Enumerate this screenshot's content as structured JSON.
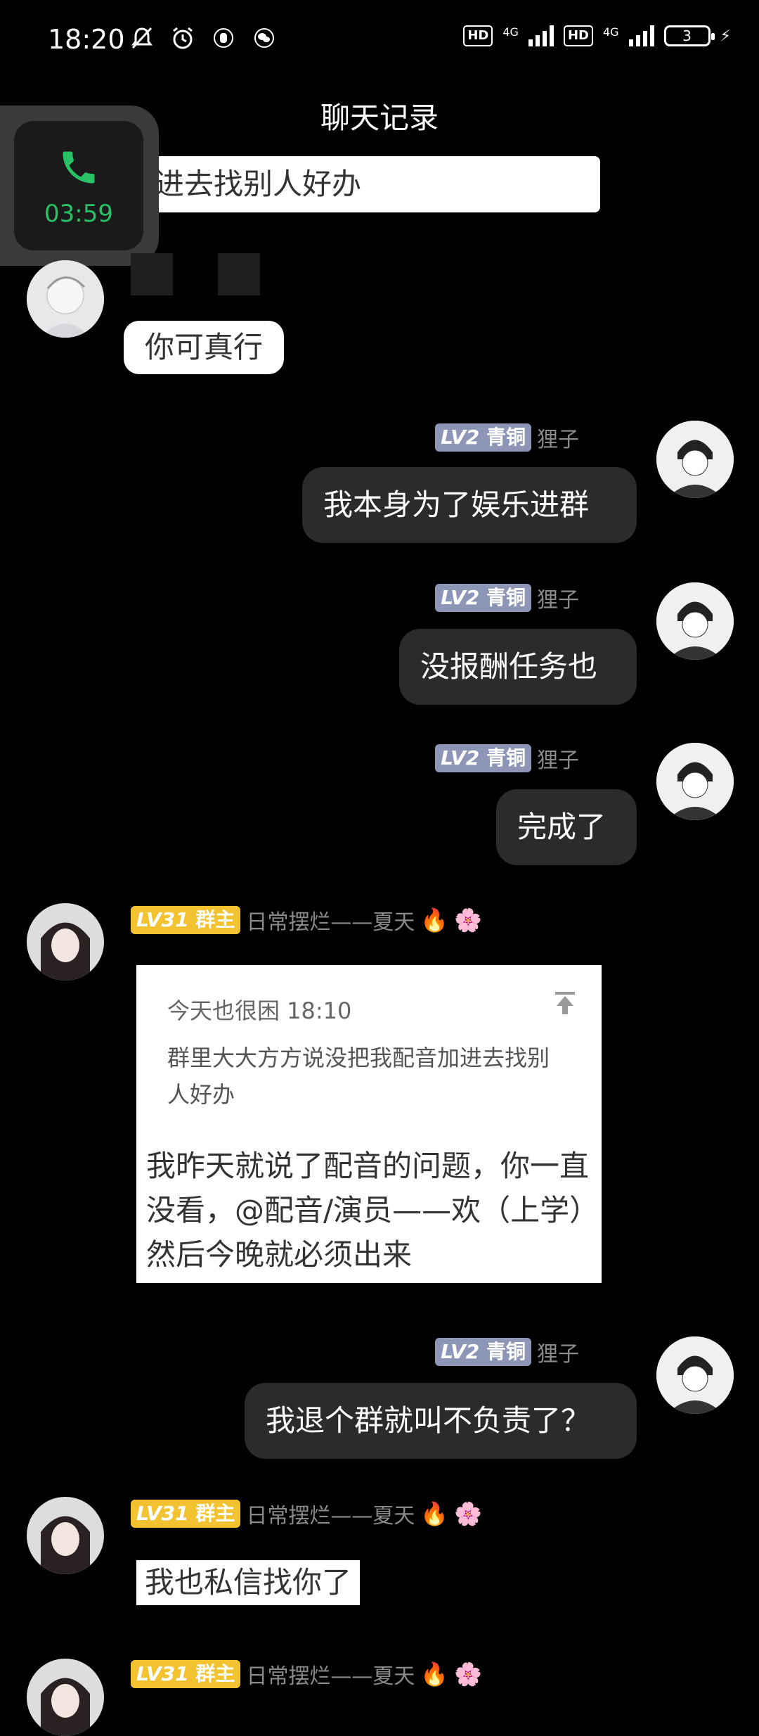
{
  "status_bar": {
    "time": "18:20",
    "battery": "3",
    "net1": "4G",
    "net2": "4G",
    "hd": "HD"
  },
  "nav": {
    "title": "聊天记录"
  },
  "call": {
    "duration": "03:59"
  },
  "messages": {
    "partial_top": "进去找别人好办",
    "m1": "你可真行",
    "m2": {
      "level": "LV2",
      "rank": "青铜",
      "name": "狸子",
      "text": "我本身为了娱乐进群"
    },
    "m3": {
      "level": "LV2",
      "rank": "青铜",
      "name": "狸子",
      "text": "没报酬任务也"
    },
    "m4": {
      "level": "LV2",
      "rank": "青铜",
      "name": "狸子",
      "text": "完成了"
    },
    "m5": {
      "level": "LV31",
      "rank": "群主",
      "name": "日常摆烂——夏天",
      "quote_header": "今天也很困 18:10",
      "quote_text": "群里大大方方说没把我配音加进去找别人好办",
      "text": "我昨天就说了配音的问题，你一直没看，@配音/演员——欢（上学）然后今晚就必须出来"
    },
    "m6": {
      "level": "LV2",
      "rank": "青铜",
      "name": "狸子",
      "text": "我退个群就叫不负责了？"
    },
    "m7": {
      "level": "LV31",
      "rank": "群主",
      "name": "日常摆烂——夏天",
      "text": "我也私信找你了"
    },
    "m8": {
      "level": "LV31",
      "rank": "群主",
      "name": "日常摆烂——夏天"
    }
  },
  "colors": {
    "background": "#000000",
    "dark_bubble": "#2b2b2b",
    "call_green": "#29c166",
    "lv2_badge": "#8e96b8",
    "lv31_badge": "#f2c230"
  }
}
